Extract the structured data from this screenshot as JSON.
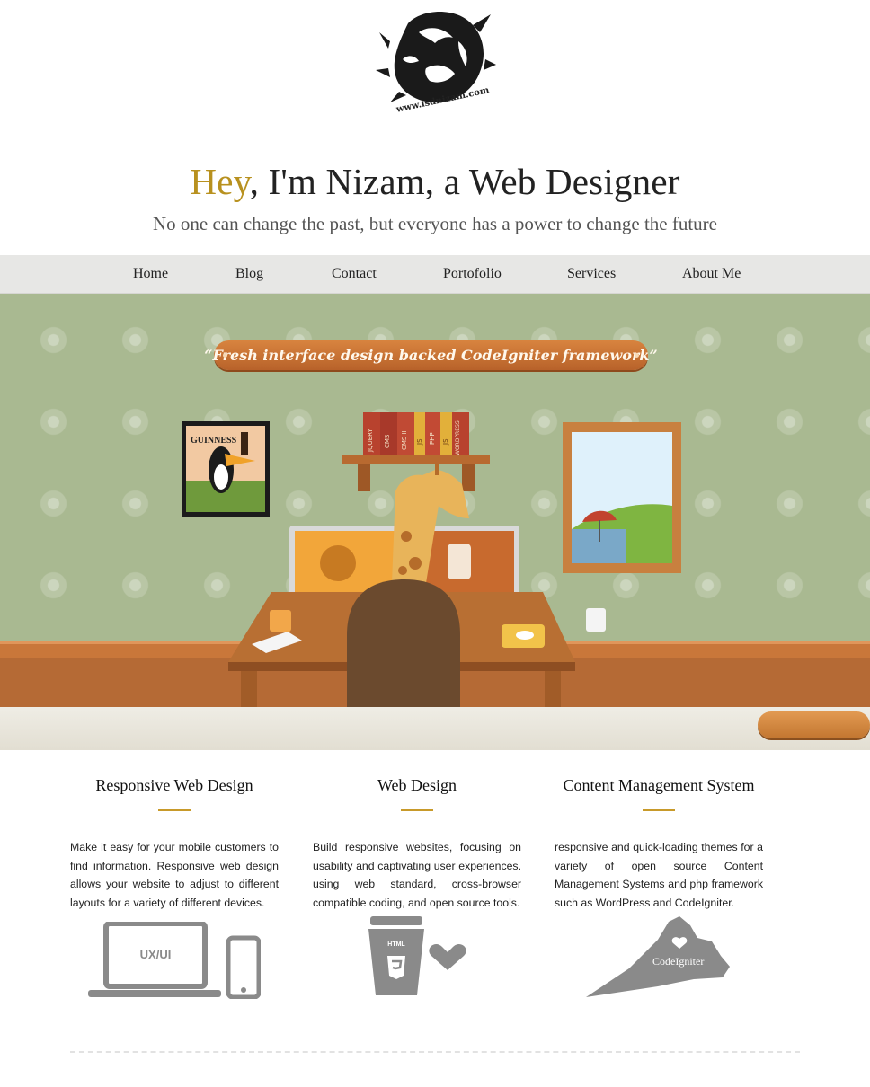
{
  "header": {
    "logo_text": "www.isdnizam.com",
    "headline_hey": "Hey",
    "headline_rest": ", I'm Nizam, a Web Designer",
    "tagline": "No one can change the past, but everyone has a power to change the future"
  },
  "nav": {
    "items": [
      {
        "label": "Home"
      },
      {
        "label": "Blog"
      },
      {
        "label": "Contact"
      },
      {
        "label": "Portofolio"
      },
      {
        "label": "Services"
      },
      {
        "label": "About Me"
      }
    ]
  },
  "hero": {
    "banner_text": "“Fresh interface design backed CodeIgniter framework”",
    "poster_text": "GUINNESS",
    "books": [
      "JQUERY",
      "CMS",
      "CMS II",
      "JS",
      "PHP",
      "JS",
      "WORDPRESS"
    ]
  },
  "features": [
    {
      "title": "Responsive Web Design",
      "text": "Make it easy for your mobile customers to find information. Responsive web design allows your website to adjust to different layouts for a variety of different devices.",
      "icon": "laptop-phone-icon",
      "icon_label": "UX/UI"
    },
    {
      "title": "Web Design",
      "text": "Build responsive websites, focusing on usability and captivating user experiences. using web standard, cross-browser compatible coding, and open source tools.",
      "icon": "html5-cup-heart-icon",
      "icon_label": "HTML"
    },
    {
      "title": "Content Management System",
      "text": "responsive and quick-loading themes for a variety of open source Content Management Systems and php framework such as WordPress and CodeIgniter.",
      "icon": "state-map-icon",
      "icon_label": "CodeIgniter"
    }
  ],
  "colors": {
    "accent": "#b8911f",
    "nav_bg": "#e7e7e5",
    "hero_wall": "#a9b991",
    "banner": "#c96f33",
    "icon_gray": "#8a8a8a"
  }
}
